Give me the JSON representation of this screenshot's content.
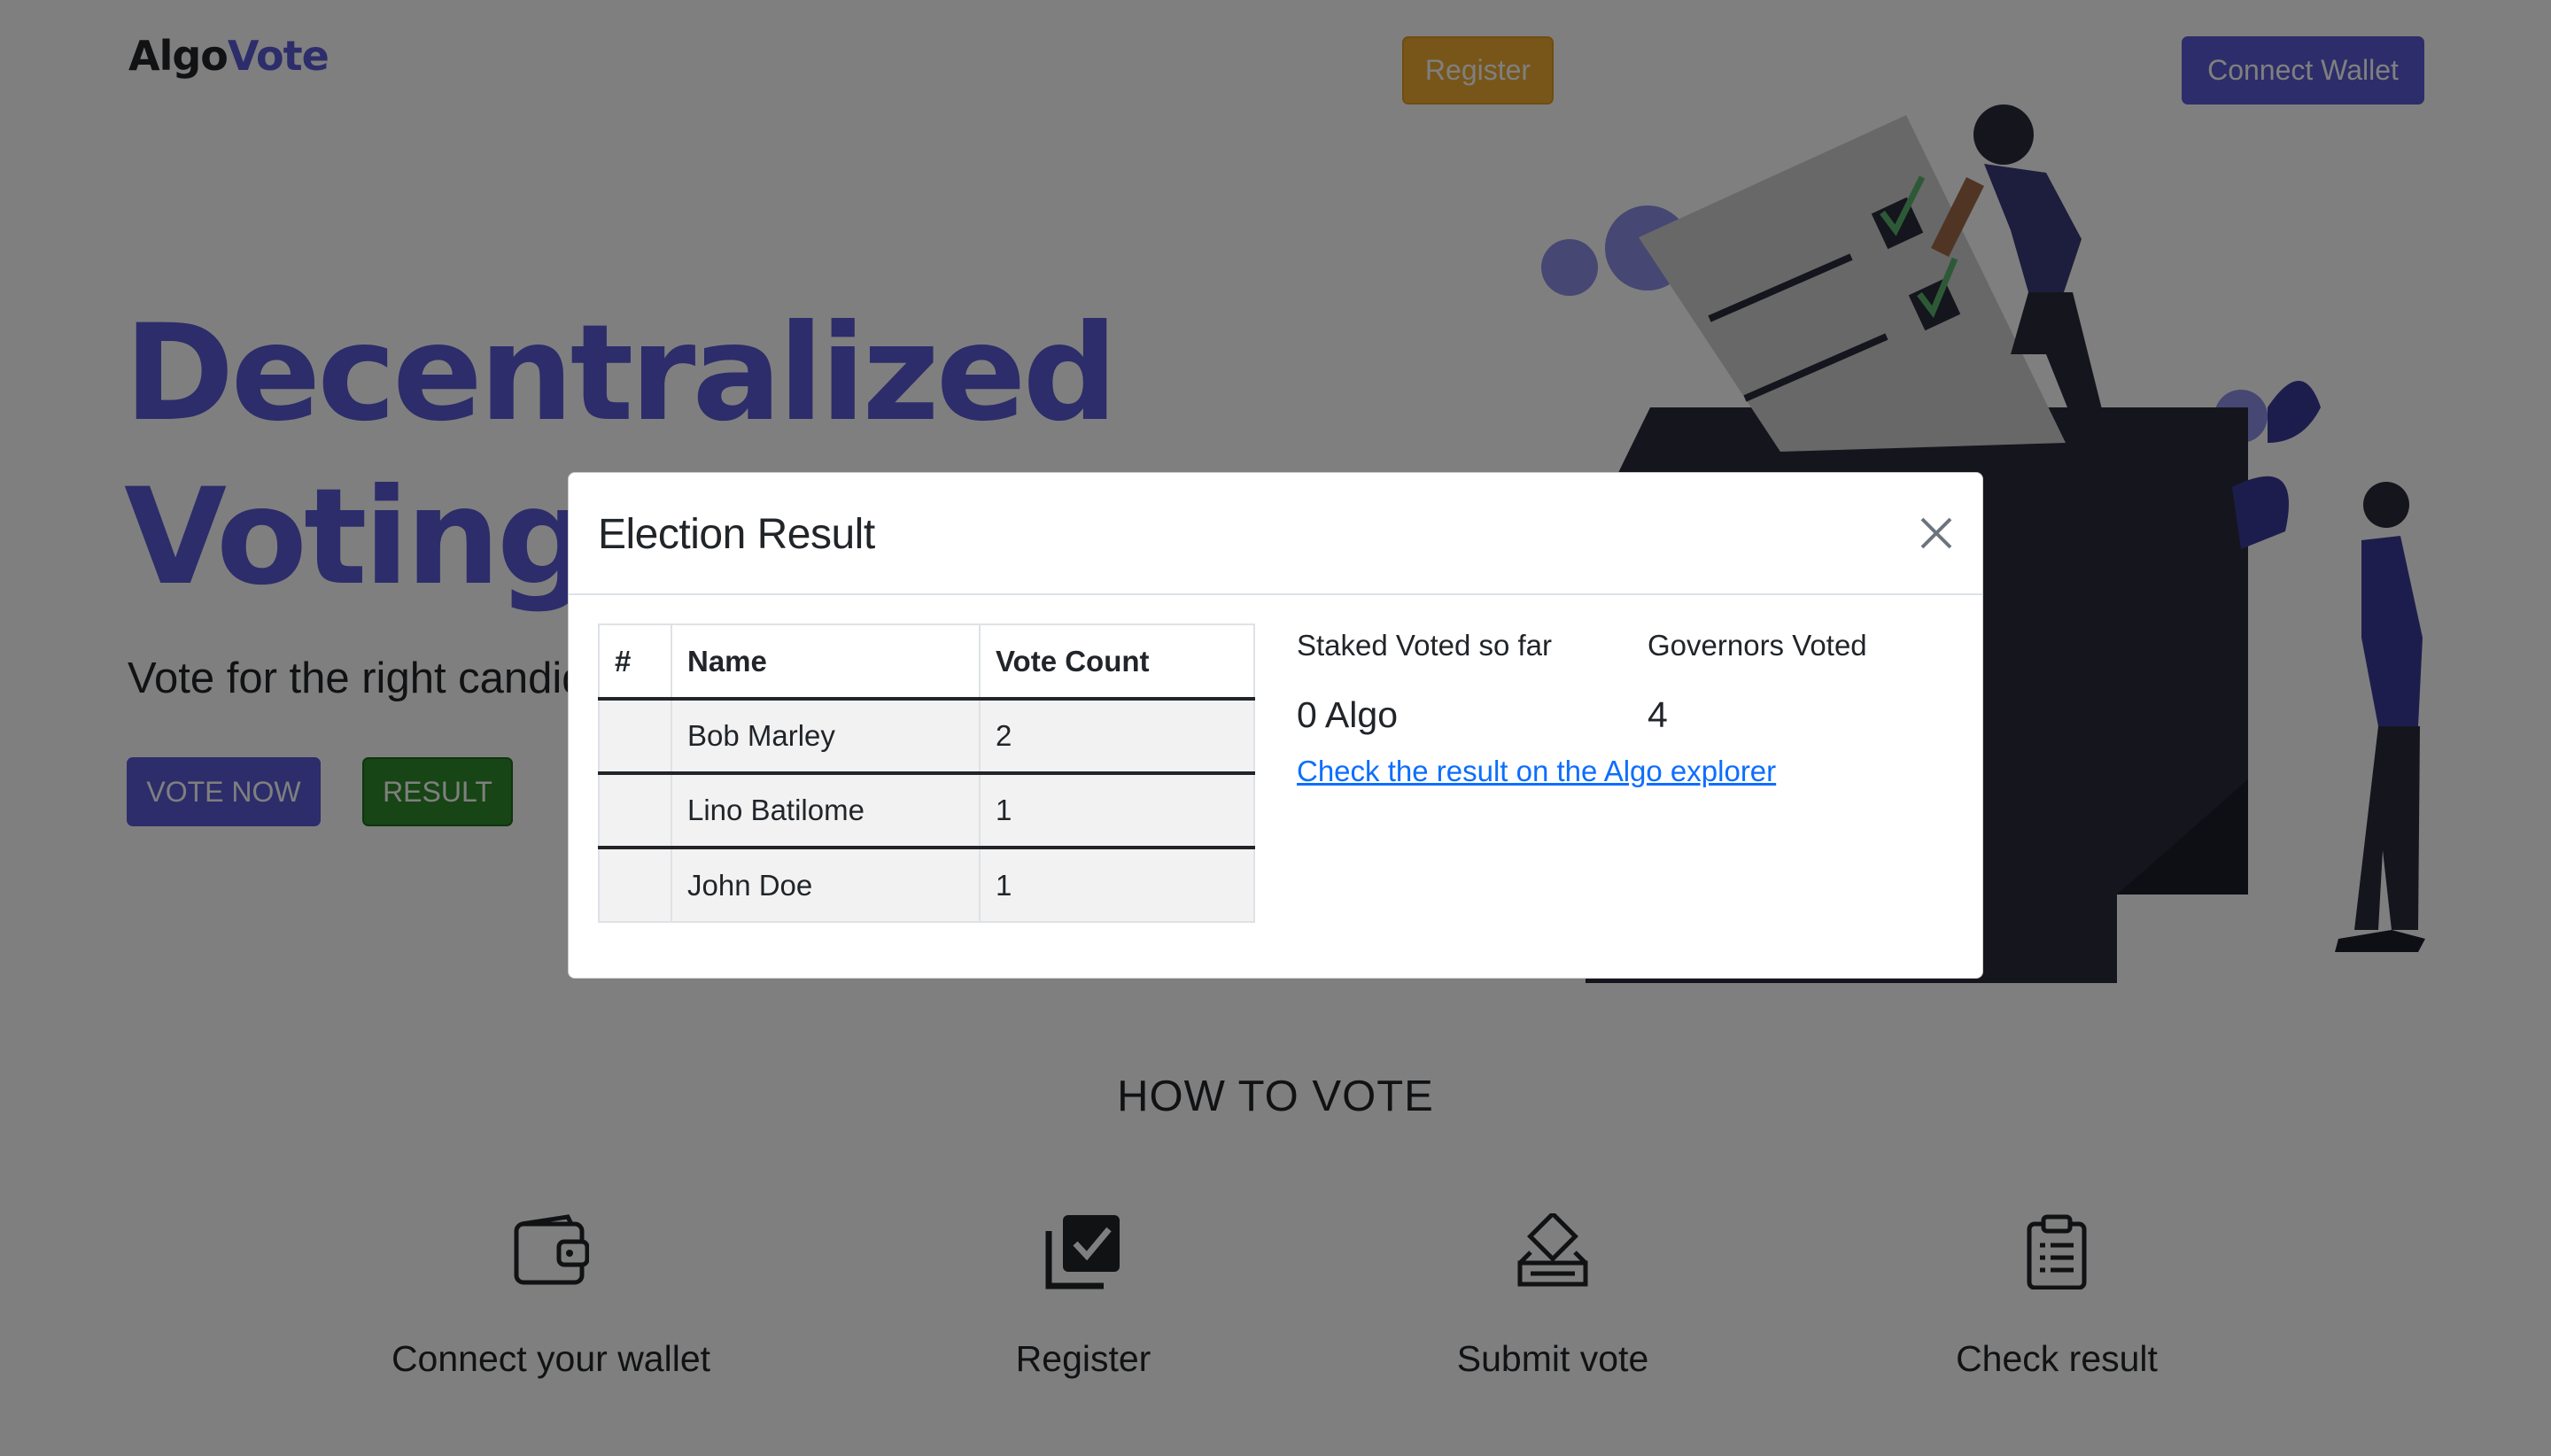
{
  "header": {
    "logo_part1": "Algo",
    "logo_part2": "Vote",
    "register_label": "Register",
    "connect_wallet_label": "Connect Wallet"
  },
  "hero": {
    "title_line1": "Decentralized",
    "title_line2": "Voting",
    "subtitle": "Vote for the right candida",
    "vote_now_label": "VOTE NOW",
    "result_label": "RESULT"
  },
  "how_to_vote": {
    "title": "HOW TO VOTE",
    "steps": [
      {
        "label": "Connect your wallet",
        "icon": "wallet-icon"
      },
      {
        "label": "Register",
        "icon": "checkbox-stack-icon"
      },
      {
        "label": "Submit vote",
        "icon": "ballot-box-icon"
      },
      {
        "label": "Check result",
        "icon": "clipboard-list-icon"
      }
    ]
  },
  "modal": {
    "title": "Election Result",
    "table": {
      "headers": [
        "#",
        "Name",
        "Vote Count"
      ],
      "rows": [
        {
          "index": "",
          "name": "Bob Marley",
          "votes": "2"
        },
        {
          "index": "",
          "name": "Lino Batilome",
          "votes": "1"
        },
        {
          "index": "",
          "name": "John Doe",
          "votes": "1"
        }
      ]
    },
    "staked_label": "Staked Voted so far",
    "staked_value": "0 Algo",
    "governors_label": "Governors Voted",
    "governors_value": "4",
    "explorer_link": "Check the result on the Algo explorer"
  },
  "colors": {
    "brand": "#5b5bd6",
    "register": "#f0ad32",
    "result": "#2f8a2b",
    "link": "#0d6efd"
  }
}
